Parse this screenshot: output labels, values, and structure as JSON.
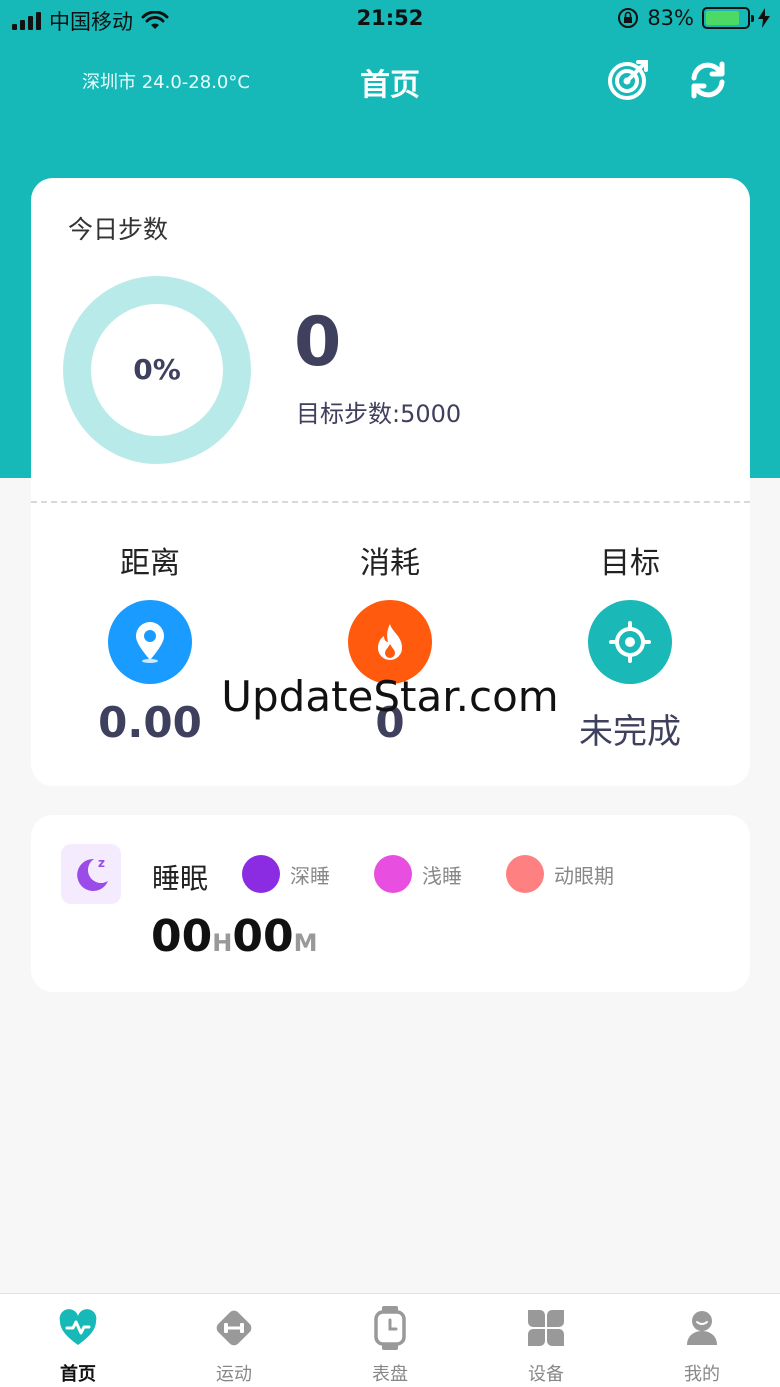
{
  "status_bar": {
    "carrier": "中国移动",
    "time": "21:52",
    "battery_percent": "83%",
    "battery_level": 0.83
  },
  "header": {
    "weather": "深圳市 24.0-28.0°C",
    "title": "首页",
    "icons": [
      "target-icon",
      "sync-icon"
    ]
  },
  "steps": {
    "label": "今日步数",
    "percent_text": "0%",
    "percent_value": 0,
    "count": "0",
    "goal": "目标步数:5000"
  },
  "stats": [
    {
      "label": "距离",
      "value": "0.00",
      "icon": "location-pin-icon",
      "color": "#1a9bff"
    },
    {
      "label": "消耗",
      "value": "0",
      "icon": "flame-icon",
      "color": "#ff5a0d"
    },
    {
      "label": "目标",
      "value": "未完成",
      "icon": "target-icon",
      "color": "#1bb8b8"
    }
  ],
  "watermark": "UpdateStar.com",
  "sleep": {
    "label": "睡眠",
    "icon": "moon-icon",
    "legend": [
      {
        "label": "深睡",
        "color": "#8b2be2"
      },
      {
        "label": "浅睡",
        "color": "#e84fe0"
      },
      {
        "label": "动眼期",
        "color": "#ff8080"
      }
    ],
    "hours": "00",
    "hours_unit": "H",
    "minutes": "00",
    "minutes_unit": "M"
  },
  "tabs": [
    {
      "label": "首页",
      "icon": "heart-pulse-icon",
      "active": true
    },
    {
      "label": "运动",
      "icon": "dumbbell-icon",
      "active": false
    },
    {
      "label": "表盘",
      "icon": "watch-icon",
      "active": false
    },
    {
      "label": "设备",
      "icon": "clover-icon",
      "active": false
    },
    {
      "label": "我的",
      "icon": "user-icon",
      "active": false
    }
  ],
  "colors": {
    "accent": "#16b8b8",
    "ring_track": "#b9eaea"
  }
}
